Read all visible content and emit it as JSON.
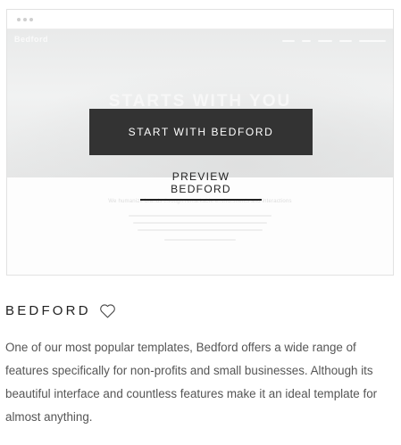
{
  "card": {
    "preview": {
      "hero_title": "STARTS WITH YOU",
      "logo_text": "Bedford",
      "faint_heading": "We humanize brands through remarkable environments and interactions"
    },
    "start_button_label": "START WITH BEDFORD",
    "preview_link_label": "PREVIEW BEDFORD"
  },
  "template": {
    "name": "BEDFORD",
    "favorite_icon": "heart-outline-icon",
    "description": "One of our most popular templates, Bedford offers a wide range of features specifically for non-profits and small businesses. Although its beautiful interface and countless features make it an ideal template for almost anything."
  },
  "colors": {
    "button_bg": "#333333",
    "button_text": "#ffffff",
    "title_text": "#222222",
    "description_text": "#555555"
  }
}
